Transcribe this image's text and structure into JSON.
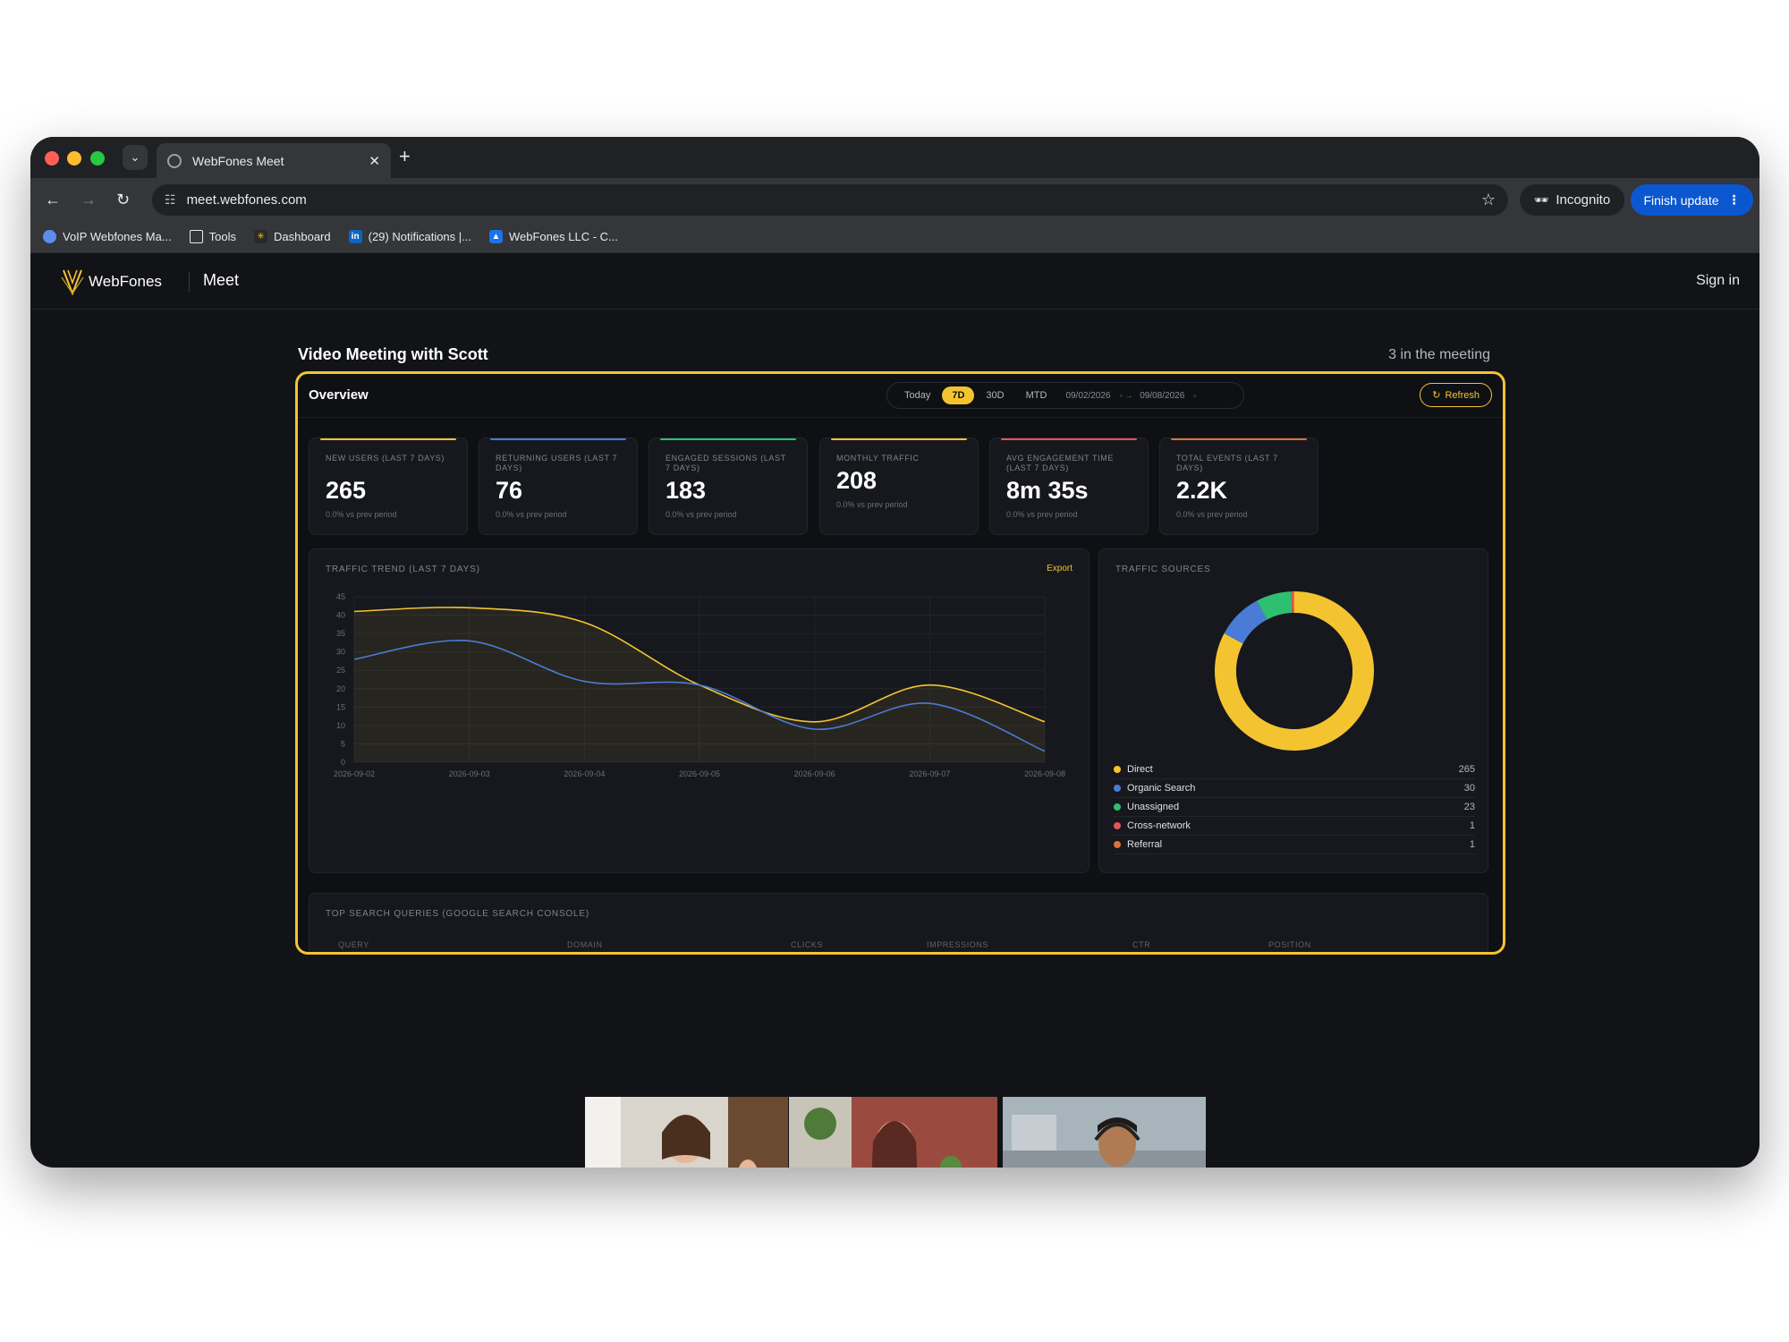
{
  "browser": {
    "tab_title": "WebFones Meet",
    "new_tab_symbol": "+",
    "url": "meet.webfones.com",
    "incognito_label": "Incognito",
    "finish_update_label": "Finish update",
    "bookmarks": [
      {
        "label": "VoIP Webfones Ma...",
        "icon": "globe-icon"
      },
      {
        "label": "Tools",
        "icon": "folder-icon"
      },
      {
        "label": "Dashboard",
        "icon": "dashboard-favicon"
      },
      {
        "label": "(29) Notifications |...",
        "icon": "linkedin-icon"
      },
      {
        "label": "WebFones LLC - C...",
        "icon": "webfones-favicon"
      }
    ]
  },
  "app": {
    "brand": "WebFones",
    "product": "Meet",
    "signin_label": "Sign in",
    "accent": "#f4c430"
  },
  "meeting": {
    "title": "Video Meeting with Scott",
    "count": "3 in the meeting"
  },
  "overview": {
    "title": "Overview",
    "ranges": [
      "Today",
      "7D",
      "30D",
      "MTD"
    ],
    "active_range": "7D",
    "date_from": "09/02/2026",
    "date_to": "09/08/2026",
    "refresh_label": "Refresh",
    "kpis": [
      {
        "label": "NEW USERS (LAST 7 DAYS)",
        "value": "265",
        "sub": "0.0% vs prev period",
        "color": "#f4c430"
      },
      {
        "label": "RETURNING USERS (LAST 7 DAYS)",
        "value": "76",
        "sub": "0.0% vs prev period",
        "color": "#4a7bd6"
      },
      {
        "label": "ENGAGED SESSIONS (LAST 7 DAYS)",
        "value": "183",
        "sub": "0.0% vs prev period",
        "color": "#2fbf71"
      },
      {
        "label": "MONTHLY TRAFFIC",
        "value": "208",
        "sub": "0.0% vs prev period",
        "color": "#f4c430"
      },
      {
        "label": "AVG ENGAGEMENT TIME (LAST 7 DAYS)",
        "value": "8m 35s",
        "sub": "0.0% vs prev period",
        "color": "#e25555"
      },
      {
        "label": "TOTAL EVENTS (LAST 7 DAYS)",
        "value": "2.2K",
        "sub": "0.0% vs prev period",
        "color": "#e0703a"
      }
    ],
    "trend_title": "TRAFFIC TREND (LAST 7 DAYS)",
    "export_label": "Export",
    "sources_title": "TRAFFIC SOURCES",
    "queries_title": "TOP SEARCH QUERIES (GOOGLE SEARCH CONSOLE)",
    "query_columns": [
      "QUERY",
      "DOMAIN",
      "CLICKS",
      "IMPRESSIONS",
      "CTR",
      "POSITION"
    ]
  },
  "chart_data": [
    {
      "type": "line",
      "title": "TRAFFIC TREND (LAST 7 DAYS)",
      "x": [
        "2026-09-02",
        "2026-09-03",
        "2026-09-04",
        "2026-09-05",
        "2026-09-06",
        "2026-09-07",
        "2026-09-08"
      ],
      "ylim": [
        0,
        45
      ],
      "yticks": [
        0,
        5,
        10,
        15,
        20,
        25,
        30,
        35,
        40,
        45
      ],
      "grid": true,
      "series": [
        {
          "values": [
            41,
            42,
            38,
            21,
            11,
            21,
            11
          ],
          "color": "#f4c430",
          "fill": true
        },
        {
          "values": [
            28,
            33,
            22,
            21,
            9,
            16,
            3
          ],
          "color": "#4a7bd6",
          "fill": false
        }
      ]
    },
    {
      "type": "pie",
      "title": "TRAFFIC SOURCES",
      "donut": true,
      "labels": [
        "Direct",
        "Organic Search",
        "Unassigned",
        "Cross-network",
        "Referral"
      ],
      "values": [
        265,
        30,
        23,
        1,
        1
      ],
      "colors": [
        "#f4c430",
        "#4a7bd6",
        "#2fbf71",
        "#e25555",
        "#e0703a"
      ]
    }
  ],
  "call": {
    "participants": [
      "participant-1",
      "participant-2",
      "participant-3"
    ],
    "controls": [
      "share-screen",
      "camera",
      "end-call",
      "microphone"
    ],
    "end_call_color": "#ea3d36"
  }
}
